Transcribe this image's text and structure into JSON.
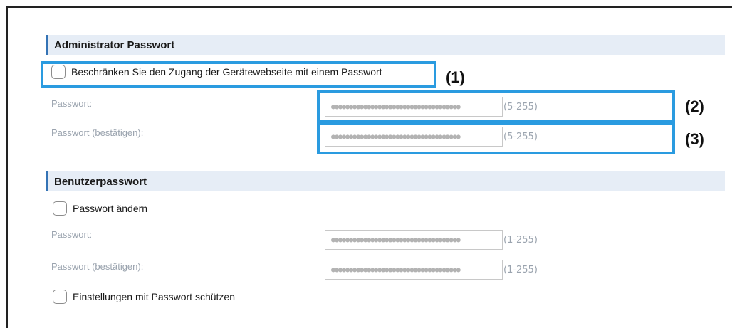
{
  "admin_section": {
    "title": "Administrator Passwort",
    "restrict_checkbox_label": "Beschränken Sie den Zugang der Gerätewebseite mit einem Passwort",
    "restrict_checked": false,
    "password_label": "Passwort:",
    "password_value": "●●●●●●●●●●●●●●●●●●●●●●●●●●●●●●●●●●●●",
    "password_range": "(5-255)",
    "confirm_label": "Passwort (bestätigen):",
    "confirm_value": "●●●●●●●●●●●●●●●●●●●●●●●●●●●●●●●●●●●●",
    "confirm_range": "(5-255)"
  },
  "user_section": {
    "title": "Benutzerpasswort",
    "change_checkbox_label": "Passwort ändern",
    "change_checked": false,
    "password_label": "Passwort:",
    "password_value": "●●●●●●●●●●●●●●●●●●●●●●●●●●●●●●●●●●●●",
    "password_range": "(1-255)",
    "confirm_label": "Passwort (bestätigen):",
    "confirm_value": "●●●●●●●●●●●●●●●●●●●●●●●●●●●●●●●●●●●●",
    "confirm_range": "(1-255)",
    "protect_checkbox_label": "Einstellungen mit Passwort schützen",
    "protect_checked": false
  },
  "callouts": {
    "one": "(1)",
    "two": "(2)",
    "three": "(3)",
    "color": "#2a9be0"
  },
  "colors": {
    "accent_bar": "#3473b5",
    "header_bg": "#e6edf6",
    "muted_label": "#9aa3ae"
  }
}
